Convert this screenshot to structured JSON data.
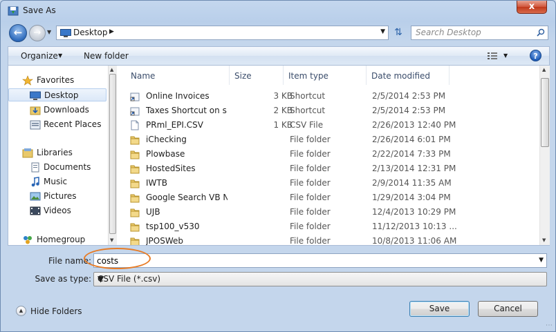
{
  "window": {
    "title": "Save As",
    "close_label": "x"
  },
  "address": {
    "location": "Desktop",
    "search_placeholder": "Search Desktop"
  },
  "toolbar": {
    "organize_label": "Organize",
    "new_folder_label": "New folder",
    "help_label": "?"
  },
  "nav": {
    "favorites": "Favorites",
    "desktop": "Desktop",
    "downloads": "Downloads",
    "recent_places": "Recent Places",
    "libraries": "Libraries",
    "documents": "Documents",
    "music": "Music",
    "pictures": "Pictures",
    "videos": "Videos",
    "homegroup": "Homegroup"
  },
  "columns": {
    "name": "Name",
    "size": "Size",
    "type": "Item type",
    "date": "Date modified"
  },
  "files": [
    {
      "name": "Online Invoices",
      "size": "3 KB",
      "type": "Shortcut",
      "date": "2/5/2014 2:53 PM",
      "icon": "shortcut-icon"
    },
    {
      "name": "Taxes Shortcut on s...",
      "size": "2 KB",
      "type": "Shortcut",
      "date": "2/5/2014 2:53 PM",
      "icon": "shortcut-icon"
    },
    {
      "name": "PRml_EPI.CSV",
      "size": "1 KB",
      "type": "CSV File",
      "date": "2/26/2013 12:40 PM",
      "icon": "csv-file-icon"
    },
    {
      "name": "iChecking",
      "size": "",
      "type": "File folder",
      "date": "2/26/2014 6:01 PM",
      "icon": "folder-icon"
    },
    {
      "name": "Plowbase",
      "size": "",
      "type": "File folder",
      "date": "2/22/2014 7:33 PM",
      "icon": "folder-icon"
    },
    {
      "name": "HostedSites",
      "size": "",
      "type": "File folder",
      "date": "2/13/2014 12:31 PM",
      "icon": "folder-icon"
    },
    {
      "name": "IWTB",
      "size": "",
      "type": "File folder",
      "date": "2/9/2014 11:35 AM",
      "icon": "folder-icon"
    },
    {
      "name": "Google Search VB N...",
      "size": "",
      "type": "File folder",
      "date": "1/29/2014 3:04 PM",
      "icon": "folder-icon"
    },
    {
      "name": "UJB",
      "size": "",
      "type": "File folder",
      "date": "12/4/2013 10:29 PM",
      "icon": "folder-icon"
    },
    {
      "name": "tsp100_v530",
      "size": "",
      "type": "File folder",
      "date": "11/12/2013 10:13 ...",
      "icon": "folder-icon"
    },
    {
      "name": "JPOSWeb",
      "size": "",
      "type": "File folder",
      "date": "10/8/2013 11:06 AM",
      "icon": "folder-icon"
    }
  ],
  "form": {
    "file_name_label": "File name:",
    "file_name_value": "costs",
    "save_as_type_label": "Save as type:",
    "save_as_type_value": "CSV File (*.csv)"
  },
  "footer": {
    "hide_folders_label": "Hide Folders",
    "save_label": "Save",
    "cancel_label": "Cancel"
  },
  "colors": {
    "annotation_circle": "#e87b24",
    "accent": "#2f6cbd"
  }
}
